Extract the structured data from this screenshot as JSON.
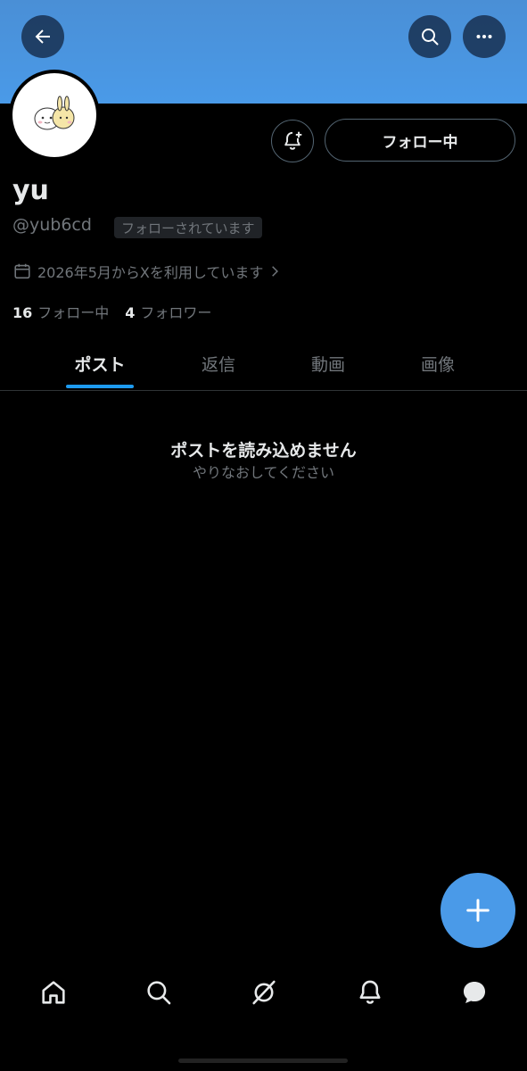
{
  "header": {
    "back_icon": "arrow-left-icon",
    "search_icon": "search-icon",
    "more_icon": "more-horizontal-icon",
    "banner_color": "#4a9ae8"
  },
  "profile": {
    "display_name": "yu",
    "handle": "@yub6cd",
    "follows_you_badge": "フォローされています",
    "joined": "2026年5月からXを利用しています",
    "following_count": "16",
    "following_label": "フォロー中",
    "followers_count": "4",
    "followers_label": "フォロワー"
  },
  "actions": {
    "notify_icon": "bell-plus-icon",
    "follow_button": "フォロー中"
  },
  "tabs": [
    {
      "label": "ポスト",
      "active": true
    },
    {
      "label": "返信",
      "active": false
    },
    {
      "label": "動画",
      "active": false
    },
    {
      "label": "画像",
      "active": false
    }
  ],
  "empty_state": {
    "title": "ポストを読み込めません",
    "subtitle": "やりなおしてください"
  },
  "fab": {
    "icon": "plus-icon"
  },
  "bottom_nav": [
    {
      "icon": "home-icon"
    },
    {
      "icon": "search-icon"
    },
    {
      "icon": "grok-icon"
    },
    {
      "icon": "bell-icon"
    },
    {
      "icon": "messages-icon"
    }
  ],
  "accent_color": "#1d9bf0"
}
